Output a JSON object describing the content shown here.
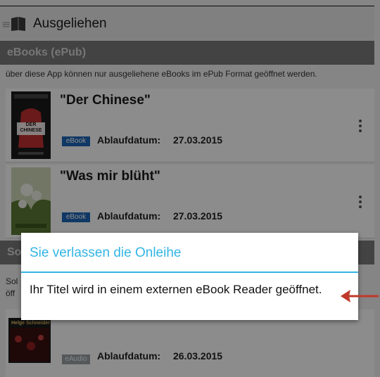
{
  "app": {
    "title": "Ausgeliehen"
  },
  "section_epub": {
    "header": "eBooks (ePub)",
    "info": "über diese App können nur ausgeliehene eBooks im ePub Format geöffnet werden."
  },
  "items": [
    {
      "title": "\"Der Chinese\"",
      "badge": "eBook",
      "date_label": "Ablaufdatum:",
      "date_value": "27.03.2015",
      "cover_text": [
        "DER",
        "CHINESE"
      ]
    },
    {
      "title": "\"Was mir blüht\"",
      "badge": "eBook",
      "date_label": "Ablaufdatum:",
      "date_value": "27.03.2015"
    },
    {
      "badge": "eAudio",
      "date_label": "Ablaufdatum:",
      "date_value": "26.03.2015",
      "cover_text": [
        "Helge Schneider"
      ]
    }
  ],
  "section_other": {
    "header_partial": "So",
    "info_partial": [
      "Sol",
      "öff"
    ]
  },
  "dialog": {
    "title": "Sie verlassen die Onleihe",
    "message": "Ihr Titel wird in einem externen eBook Reader geöffnet."
  },
  "colors": {
    "accent": "#33b5e5",
    "ebook_badge": "#1e66b8",
    "arrow": "#c0392b"
  }
}
